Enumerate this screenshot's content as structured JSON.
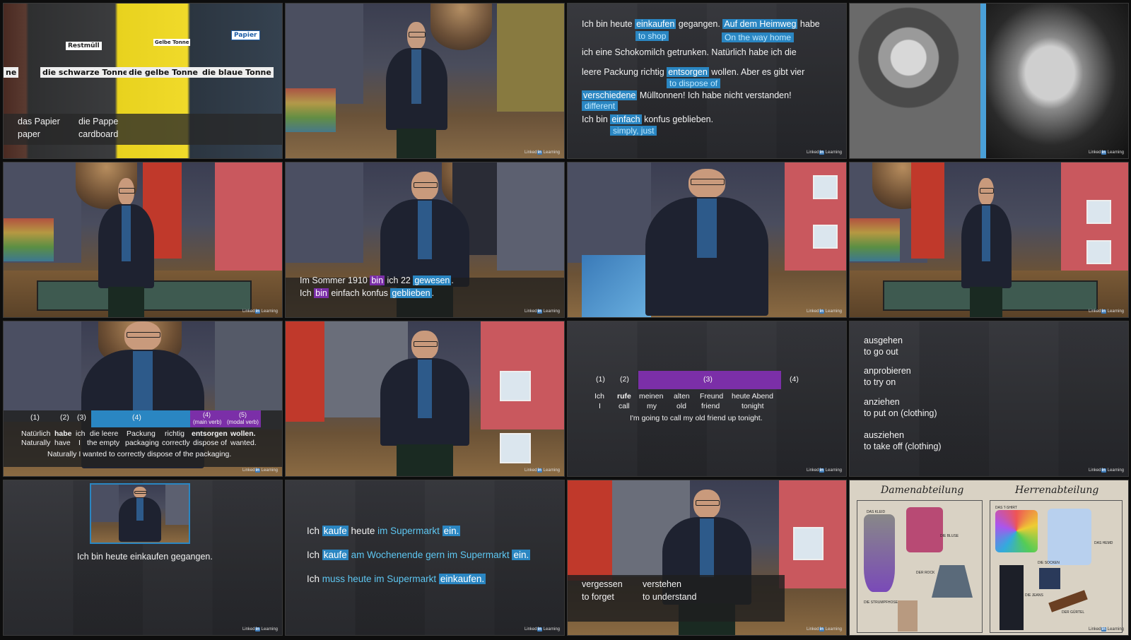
{
  "logo_text": "Linked",
  "logo_in": "in",
  "logo_suffix": "Learning",
  "t1": {
    "bins": [
      "Restmüll",
      "Gelbe Tonne",
      "Papier"
    ],
    "labels": [
      "ne",
      "die schwarze Tonne",
      "die gelbe Tonne",
      "die blaue Tonne"
    ],
    "words": [
      {
        "de": "das Papier",
        "en": "paper"
      },
      {
        "de": "die Pappe",
        "en": "cardboard"
      }
    ]
  },
  "t3": {
    "l1a": "Ich bin heute ",
    "l1b": "einkaufen",
    "l1c": " gegangen. ",
    "l1d": "Auf dem Heimweg",
    "l1e": " habe",
    "g1a": "to shop",
    "g1b": "On the way home",
    "l2": "ich eine Schokomilch getrunken. Natürlich habe ich die",
    "l3a": "leere Packung richtig ",
    "l3b": "entsorgen",
    "l3c": " wollen. Aber es gibt vier",
    "g3": "to dispose of",
    "l4a": "verschiedene",
    "l4b": " Mülltonnen! Ich habe nicht verstanden!",
    "g4": "different",
    "l5a": "Ich bin ",
    "l5b": "einfach",
    "l5c": " konfus geblieben.",
    "g5": "simply, just"
  },
  "t6": {
    "l1a": "Im Sommer 1910 ",
    "l1b": "bin",
    "l1c": " ich 22 ",
    "l1d": "gewesen",
    "l1e": ".",
    "l2a": "Ich ",
    "l2b": "bin",
    "l2c": " einfach konfus ",
    "l2d": "geblieben",
    "l2e": "."
  },
  "t9": {
    "nums": [
      "(1)",
      "(2)",
      "(3)",
      "(4)",
      "(4)",
      "(5)"
    ],
    "notes": [
      "(main verb)",
      "(modal verb)"
    ],
    "de": [
      "Natürlich",
      "habe",
      "ich",
      "die leere",
      "Packung",
      "richtig",
      "entsorgen",
      "wollen."
    ],
    "en": [
      "Naturally",
      "have",
      "I",
      "the empty",
      "packaging",
      "correctly",
      "dispose of",
      "wanted."
    ],
    "sentence": "Naturally I wanted to correctly dispose of the packaging."
  },
  "t11": {
    "nums": [
      "(1)",
      "(2)",
      "(3)",
      "(4)"
    ],
    "de": [
      "Ich",
      "rufe",
      "meinen",
      "alten",
      "Freund",
      "heute Abend"
    ],
    "en": [
      "I",
      "call",
      "my",
      "old",
      "friend",
      "tonight"
    ],
    "sentence": "I'm going to call my old friend up tonight."
  },
  "t12": [
    {
      "de": "ausgehen",
      "en": "to go out"
    },
    {
      "de": "anprobieren",
      "en": "to try on"
    },
    {
      "de": "anziehen",
      "en": "to put on (clothing)"
    },
    {
      "de": "ausziehen",
      "en": "to take off (clothing)"
    }
  ],
  "t13": {
    "caption": "Ich bin heute einkaufen gegangen."
  },
  "t14": {
    "s1a": "Ich ",
    "s1b": "kaufe",
    "s1c": " heute ",
    "s1d": "im Supermarkt",
    "s1e": " ",
    "s1f": "ein.",
    "s2a": "Ich ",
    "s2b": "kaufe",
    "s2c": " ",
    "s2d": "am Wochenende gern im Supermarkt",
    "s2e": " ",
    "s2f": "ein.",
    "s3a": "Ich ",
    "s3b": "muss heute im Supermarkt",
    "s3c": " ",
    "s3d": "einkaufen."
  },
  "t15": {
    "words": [
      {
        "de": "vergessen",
        "en": "to forget"
      },
      {
        "de": "verstehen",
        "en": "to understand"
      }
    ]
  },
  "t16": {
    "h1": "Damenabteilung",
    "h2": "Herrenabteilung",
    "items1": [
      "DAS KLEID",
      "DIE BLUSE",
      "DER ROCK",
      "DIE STRUMPFHOSE"
    ],
    "items2": [
      "DAS T-SHIRT",
      "DAS HEMD",
      "DIE SOCKEN",
      "DIE JEANS",
      "DER GÜRTEL"
    ]
  },
  "colors": {
    "highlight_blue": "#2a86c2",
    "highlight_purple": "#7b2fa8",
    "gloss_cyan": "#5ec7f2",
    "gloss_yellow": "#f0c23a"
  }
}
